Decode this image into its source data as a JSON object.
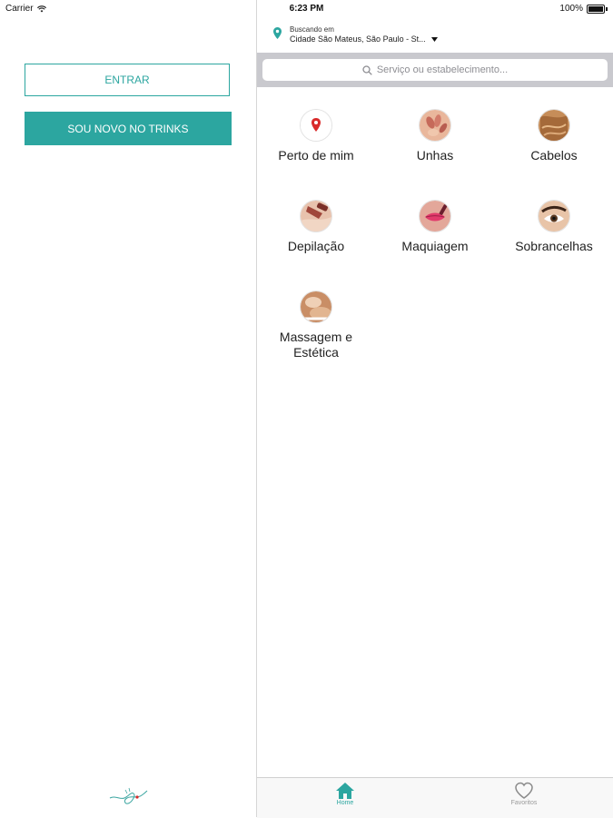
{
  "status_bar": {
    "carrier": "Carrier",
    "time": "6:23 PM",
    "battery": "100%"
  },
  "auth": {
    "login_label": "ENTRAR",
    "signup_label": "SOU NOVO NO TRINKS"
  },
  "location": {
    "caption": "Buscando em",
    "city": "Cidade São Mateus, São Paulo - St..."
  },
  "search": {
    "placeholder": "Serviço ou estabelecimento..."
  },
  "categories": [
    {
      "label": "Perto de mim",
      "icon": "location-pin-icon"
    },
    {
      "label": "Unhas",
      "icon": "nails-photo"
    },
    {
      "label": "Cabelos",
      "icon": "hair-photo"
    },
    {
      "label": "Depilação",
      "icon": "waxing-photo"
    },
    {
      "label": "Maquiagem",
      "icon": "makeup-photo"
    },
    {
      "label": "Sobrancelhas",
      "icon": "eyebrow-photo"
    },
    {
      "label": "Massagem e Estética",
      "icon": "massage-photo"
    }
  ],
  "tabs": {
    "home_label": "Home",
    "favorites_label": "Favoritos"
  },
  "colors": {
    "accent": "#2ca6a0",
    "pin_red": "#d92b2b",
    "search_bg": "#c9c9ce",
    "tab_inactive": "#9a9a9a"
  }
}
